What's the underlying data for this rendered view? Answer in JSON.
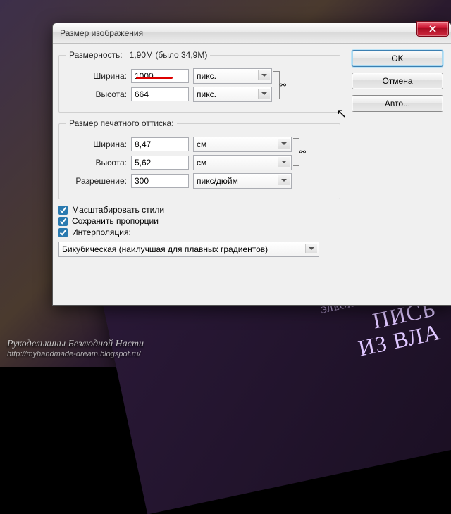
{
  "watermark": {
    "line1": "Рукоделькины Безлюдной Насти",
    "line2": "http://myhandmade-dream.blogspot.ru/"
  },
  "dialog": {
    "title": "Размер изображения",
    "buttons": {
      "ok": "OK",
      "cancel": "Отмена",
      "auto": "Авто..."
    },
    "pixel_group": {
      "legend_prefix": "Размерность:",
      "size_info": "1,90M (было 34,9M)",
      "width_label": "Ширина:",
      "width_value": "1000",
      "width_unit": "пикс.",
      "height_label": "Высота:",
      "height_value": "664",
      "height_unit": "пикс."
    },
    "print_group": {
      "legend": "Размер печатного оттиска:",
      "width_label": "Ширина:",
      "width_value": "8,47",
      "width_unit": "см",
      "height_label": "Высота:",
      "height_value": "5,62",
      "height_unit": "см",
      "res_label": "Разрешение:",
      "res_value": "300",
      "res_unit": "пикс/дюйм"
    },
    "checks": {
      "scale_styles": "Масштабировать стили",
      "constrain": "Сохранить пропорции",
      "resample": "Интерполяция:"
    },
    "resample_combo": "Бикубическая (наилучшая для плавных градиентов)"
  },
  "book": {
    "author": "ЭЛЕОНОРА ЛОРА ПРЕЙ",
    "title_l1": "ПИСЬ",
    "title_l2": "ИЗ ВЛА"
  }
}
